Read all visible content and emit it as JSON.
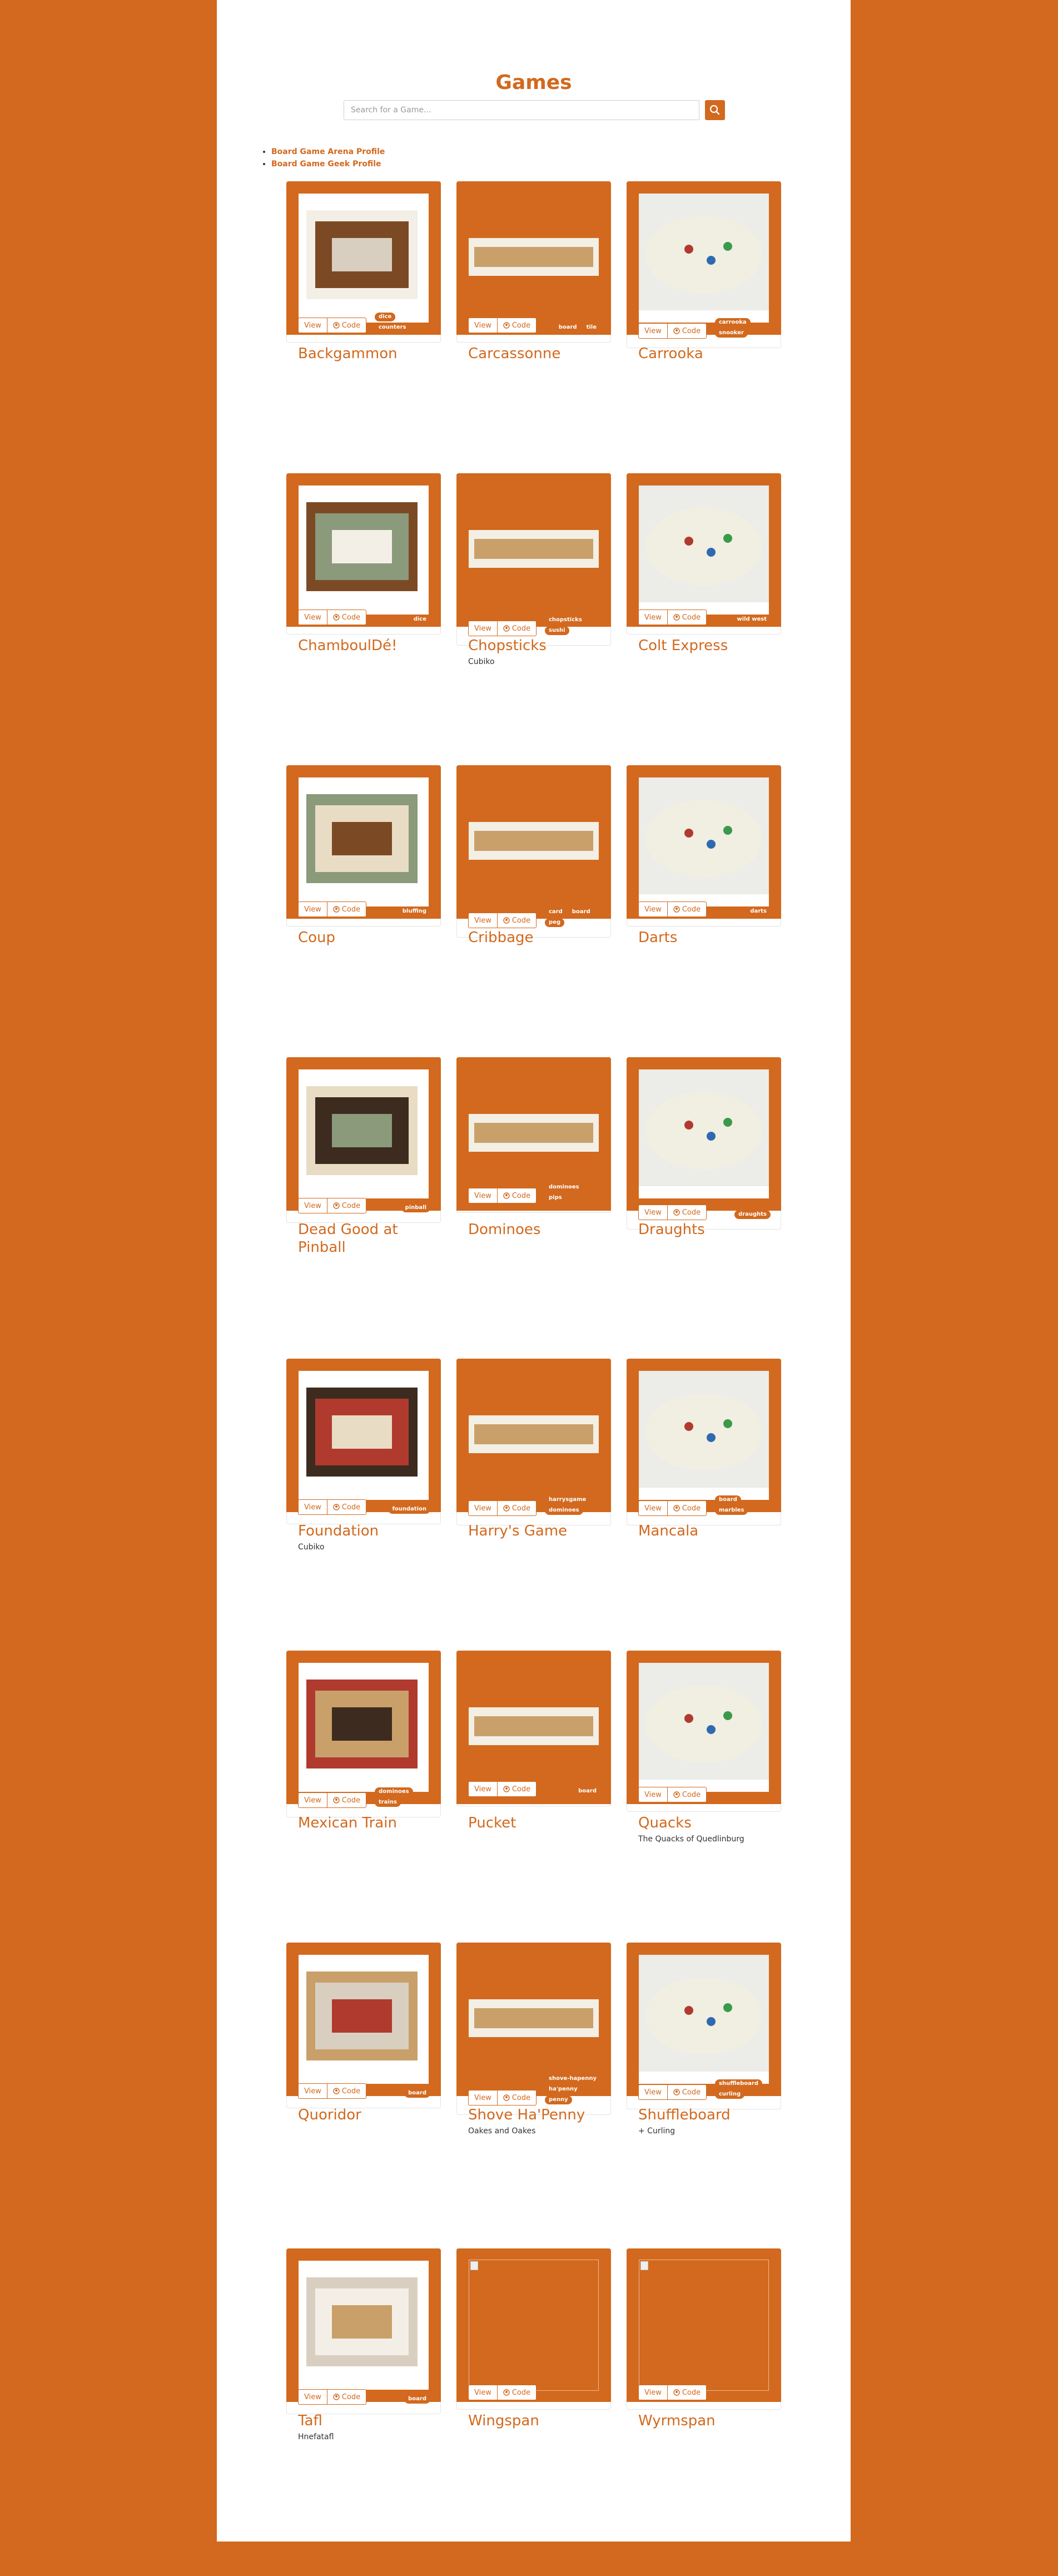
{
  "page": {
    "title": "Games",
    "search_placeholder": "Search for a Game...",
    "links": [
      "Board Game Arena Profile",
      "Board Game Geek Profile"
    ]
  },
  "buttons": {
    "view": "View",
    "code": "Code"
  },
  "colors": {
    "accent": "#d2691e",
    "page_bg": "#ffffff"
  },
  "games": [
    {
      "title": "Backgammon",
      "subtitle": "",
      "tags": [
        "dice",
        "counters"
      ]
    },
    {
      "title": "Carcassonne",
      "subtitle": "",
      "tags": [
        "board",
        "tile"
      ]
    },
    {
      "title": "Carrooka",
      "subtitle": "",
      "tags": [
        "carrooka",
        "snooker"
      ]
    },
    {
      "title": "ChamboulDé!",
      "subtitle": "",
      "tags": [
        "dice"
      ]
    },
    {
      "title": "Chopsticks",
      "subtitle": "Cubiko",
      "tags": [
        "chopsticks",
        "sushi"
      ]
    },
    {
      "title": "Colt Express",
      "subtitle": "",
      "tags": [
        "wild west"
      ]
    },
    {
      "title": "Coup",
      "subtitle": "",
      "tags": [
        "bluffing"
      ]
    },
    {
      "title": "Cribbage",
      "subtitle": "",
      "tags": [
        "card",
        "board",
        "peg"
      ]
    },
    {
      "title": "Darts",
      "subtitle": "",
      "tags": [
        "darts"
      ]
    },
    {
      "title": "Dead Good at Pinball",
      "subtitle": "",
      "tags": [
        "pinball"
      ]
    },
    {
      "title": "Dominoes",
      "subtitle": "",
      "tags": [
        "dominoes",
        "pips"
      ]
    },
    {
      "title": "Draughts",
      "subtitle": "",
      "tags": [
        "draughts"
      ]
    },
    {
      "title": "Foundation",
      "subtitle": "Cubiko",
      "tags": [
        "foundation"
      ]
    },
    {
      "title": "Harry's Game",
      "subtitle": "",
      "tags": [
        "harrysgame",
        "dominoes"
      ]
    },
    {
      "title": "Mancala",
      "subtitle": "",
      "tags": [
        "board",
        "marbles"
      ]
    },
    {
      "title": "Mexican Train",
      "subtitle": "",
      "tags": [
        "dominoes",
        "trains"
      ]
    },
    {
      "title": "Pucket",
      "subtitle": "",
      "tags": [
        "board"
      ]
    },
    {
      "title": "Quacks",
      "subtitle": "The Quacks of Quedlinburg",
      "tags": []
    },
    {
      "title": "Quoridor",
      "subtitle": "",
      "tags": [
        "board"
      ]
    },
    {
      "title": "Shove Ha'Penny",
      "subtitle": "Oakes and Oakes",
      "tags": [
        "shove-hapenny",
        "ha'penny",
        "penny"
      ]
    },
    {
      "title": "Shuffleboard",
      "subtitle": "+ Curling",
      "tags": [
        "shuffleboard",
        "curling"
      ]
    },
    {
      "title": "Tafl",
      "subtitle": "Hnefatafl",
      "tags": [
        "board"
      ]
    },
    {
      "title": "Wingspan",
      "subtitle": "",
      "tags": []
    },
    {
      "title": "Wyrmspan",
      "subtitle": "",
      "tags": []
    }
  ]
}
